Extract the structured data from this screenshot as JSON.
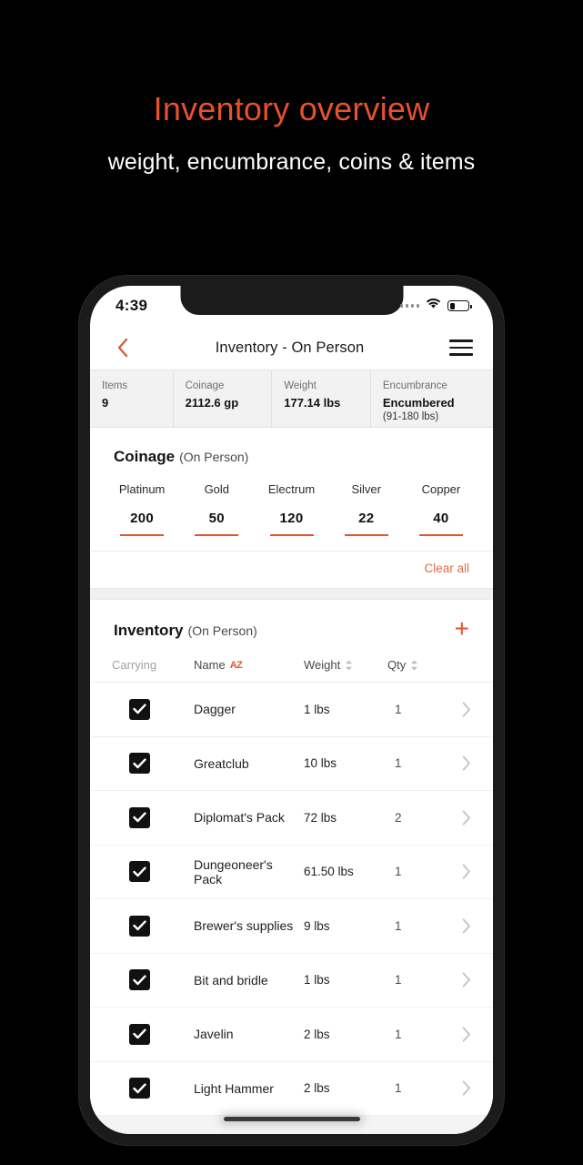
{
  "promo": {
    "title": "Inventory overview",
    "subtitle": "weight, encumbrance, coins & items",
    "title_color": "#E8512B"
  },
  "status_bar": {
    "time": "4:39",
    "signal_icon": "signal-dots-icon",
    "wifi_icon": "wifi-icon",
    "battery_icon": "battery-low-icon"
  },
  "nav": {
    "back_icon": "chevron-left-icon",
    "title": "Inventory - On Person",
    "menu_icon": "hamburger-menu-icon"
  },
  "summary": [
    {
      "label": "Items",
      "value": "9",
      "sub": ""
    },
    {
      "label": "Coinage",
      "value": "2112.6 gp",
      "sub": ""
    },
    {
      "label": "Weight",
      "value": "177.14 lbs",
      "sub": ""
    },
    {
      "label": "Encumbrance",
      "value": "Encumbered",
      "sub": "(91-180 lbs)"
    }
  ],
  "coinage": {
    "title": "Coinage",
    "scope": "(On Person)",
    "columns": [
      "Platinum",
      "Gold",
      "Electrum",
      "Silver",
      "Copper"
    ],
    "values": [
      "200",
      "50",
      "120",
      "22",
      "40"
    ],
    "clear_all_label": "Clear all",
    "underline_color": "#E8512B"
  },
  "inventory": {
    "title": "Inventory",
    "scope": "(On Person)",
    "add_icon": "plus-icon",
    "columns": {
      "carrying": "Carrying",
      "name": "Name",
      "name_sort_badge": "AZ",
      "weight": "Weight",
      "qty": "Qty"
    },
    "rows": [
      {
        "checked": true,
        "name": "Dagger",
        "weight": "1 lbs",
        "qty": "1"
      },
      {
        "checked": true,
        "name": "Greatclub",
        "weight": "10 lbs",
        "qty": "1"
      },
      {
        "checked": true,
        "name": "Diplomat's Pack",
        "weight": "72 lbs",
        "qty": "2"
      },
      {
        "checked": true,
        "name": "Dungeoneer's Pack",
        "weight": "61.50 lbs",
        "qty": "1"
      },
      {
        "checked": true,
        "name": "Brewer's supplies",
        "weight": "9 lbs",
        "qty": "1"
      },
      {
        "checked": true,
        "name": "Bit and bridle",
        "weight": "1 lbs",
        "qty": "1"
      },
      {
        "checked": true,
        "name": "Javelin",
        "weight": "2 lbs",
        "qty": "1"
      },
      {
        "checked": true,
        "name": "Light Hammer",
        "weight": "2 lbs",
        "qty": "1"
      }
    ]
  },
  "colors": {
    "accent": "#E8512B",
    "page_background": "#000000",
    "card": "#FFFFFF"
  }
}
